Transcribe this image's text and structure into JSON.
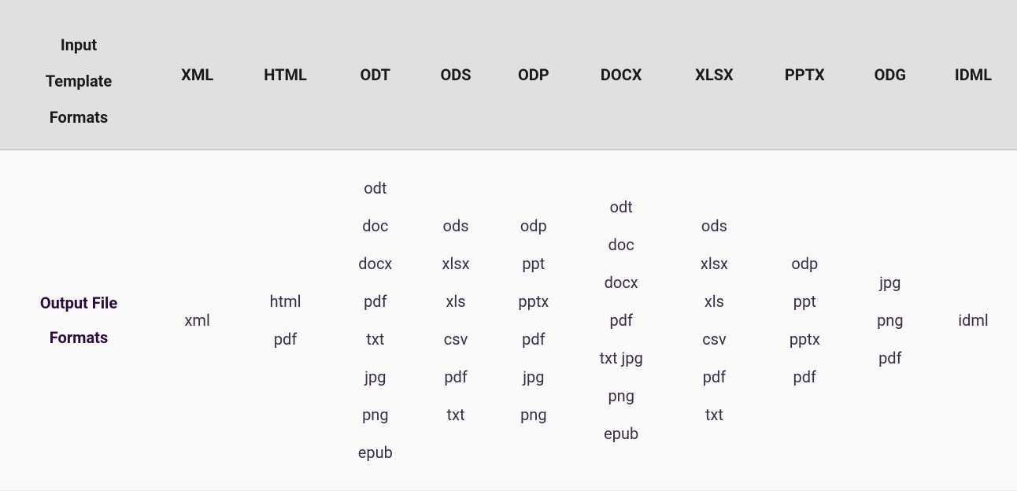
{
  "header": {
    "row_label": "Input\nTemplate\nFormats",
    "columns": [
      "XML",
      "HTML",
      "ODT",
      "ODS",
      "ODP",
      "DOCX",
      "XLSX",
      "PPTX",
      "ODG",
      "IDML"
    ]
  },
  "row": {
    "label": "Output File\nFormats",
    "cells": [
      [
        "xml"
      ],
      [
        "html",
        "pdf"
      ],
      [
        "odt",
        "doc",
        "docx",
        "pdf",
        "txt",
        "jpg",
        "png",
        "epub"
      ],
      [
        "ods",
        "xlsx",
        "xls",
        "csv",
        "pdf",
        "txt"
      ],
      [
        "odp",
        "ppt",
        "pptx",
        "pdf",
        "jpg",
        "png"
      ],
      [
        "odt",
        "doc",
        "docx",
        "pdf",
        "txt jpg",
        "png",
        "epub"
      ],
      [
        "ods",
        "xlsx",
        "xls",
        "csv",
        "pdf",
        "txt"
      ],
      [
        "odp",
        "ppt",
        "pptx",
        "pdf"
      ],
      [
        "jpg",
        "png",
        "pdf"
      ],
      [
        "idml"
      ]
    ]
  }
}
